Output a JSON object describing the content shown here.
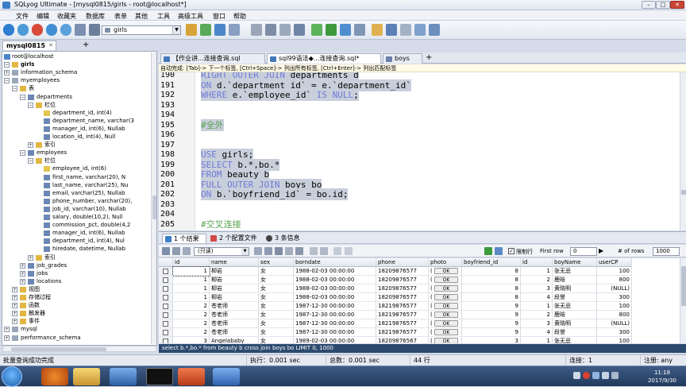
{
  "window": {
    "title": "SQLyog Ultimate - [mysql0815/girls - root@localhost*]"
  },
  "menu": [
    "文件",
    "编辑",
    "收藏夹",
    "数据库",
    "表单",
    "其他",
    "工具",
    "高级工具",
    "窗口",
    "帮助"
  ],
  "toolbar": {
    "db_selector": "girls"
  },
  "connection_tab": {
    "label": "mysql0815",
    "add": "+"
  },
  "tree": {
    "root": "root@localhost",
    "nodes": [
      {
        "label": "girls",
        "bold": true
      },
      {
        "label": "information_schema"
      },
      {
        "label": "myemployees"
      },
      {
        "label": "表"
      },
      {
        "label": "departments"
      },
      {
        "label": "栏位"
      },
      {
        "label": "department_id, int(4)"
      },
      {
        "label": "department_name, varchar(3"
      },
      {
        "label": "manager_id, int(6), Nullab"
      },
      {
        "label": "location_id, int(4), Null"
      },
      {
        "label": "索引"
      },
      {
        "label": "employees"
      },
      {
        "label": "栏位"
      },
      {
        "label": "employee_id, int(6)"
      },
      {
        "label": "first_name, varchar(20), N"
      },
      {
        "label": "last_name, varchar(25), Nu"
      },
      {
        "label": "email, varchar(25), Nullab"
      },
      {
        "label": "phone_number, varchar(20),"
      },
      {
        "label": "job_id, varchar(10), Nullab"
      },
      {
        "label": "salary, double(10,2), Null"
      },
      {
        "label": "commission_pct, double(4,2"
      },
      {
        "label": "manager_id, int(6), Nullab"
      },
      {
        "label": "department_id, int(4), Nul"
      },
      {
        "label": "hiredate, datetime, Nullab"
      },
      {
        "label": "索引"
      },
      {
        "label": "job_grades"
      },
      {
        "label": "jobs"
      },
      {
        "label": "locations"
      },
      {
        "label": "视图"
      },
      {
        "label": "存储过程"
      },
      {
        "label": "函数"
      },
      {
        "label": "触发器"
      },
      {
        "label": "事件"
      },
      {
        "label": "mysql"
      },
      {
        "label": "performance_schema"
      }
    ]
  },
  "editor_tabs": [
    {
      "label": "【作业讲...连接查询.sql"
    },
    {
      "label": "sql99语法◆...连接查询.sql*"
    },
    {
      "label": "boys"
    }
  ],
  "editor_tab_add": "+",
  "hint": "自动完成: [Tab]-> 下一个标签, [Ctrl+Space]-> 列出所有标签, [Ctrl+Enter]-> 列出匹配标签",
  "code_lines": [
    {
      "n": "190",
      "text": "RIGHT OUTER JOIN departments d"
    },
    {
      "n": "191",
      "text": "ON d.`department_id` = e.`department_id`"
    },
    {
      "n": "192",
      "text": "WHERE e.`employee_id` IS NULL;"
    },
    {
      "n": "193",
      "text": ""
    },
    {
      "n": "194",
      "text": ""
    },
    {
      "n": "195",
      "text": "#全外"
    },
    {
      "n": "196",
      "text": ""
    },
    {
      "n": "197",
      "text": ""
    },
    {
      "n": "198",
      "text": "USE girls;"
    },
    {
      "n": "199",
      "text": "SELECT b.*,bo.*"
    },
    {
      "n": "200",
      "text": "FROM beauty b"
    },
    {
      "n": "201",
      "text": "FULL OUTER JOIN boys bo"
    },
    {
      "n": "202",
      "text": "ON b.`boyfriend_id` = bo.id;"
    },
    {
      "n": "203",
      "text": ""
    },
    {
      "n": "204",
      "text": ""
    },
    {
      "n": "205",
      "text": "#交叉连接"
    }
  ],
  "result_tabs": [
    {
      "label": "1 个结果"
    },
    {
      "label": "2 个配置文件"
    },
    {
      "label": "3 条信息"
    }
  ],
  "result_toolbar": {
    "mode": "(只读)",
    "limit_label": "限制行",
    "first_row_label": "First row",
    "first_row_value": "0",
    "rows_label": "# of rows",
    "rows_value": "1000"
  },
  "grid": {
    "columns": [
      "id",
      "name",
      "sex",
      "borndate",
      "phone",
      "photo",
      "boyfriend_id",
      "id",
      "boyName",
      "userCP"
    ],
    "rows": [
      [
        "1",
        "柳岩",
        "女",
        "1988-02-03 00:00:00",
        "18209876577",
        "OK",
        "8",
        "1",
        "张无忌",
        "100"
      ],
      [
        "1",
        "柳岩",
        "女",
        "1988-02-03 00:00:00",
        "18209876577",
        "OK",
        "8",
        "2",
        "鹿晗",
        "800"
      ],
      [
        "1",
        "柳岩",
        "女",
        "1988-02-03 00:00:00",
        "18209876577",
        "OK",
        "8",
        "3",
        "黄晓明",
        "(NULL)"
      ],
      [
        "1",
        "柳岩",
        "女",
        "1988-02-03 00:00:00",
        "18209876577",
        "OK",
        "8",
        "4",
        "段誉",
        "300"
      ],
      [
        "2",
        "苍老师",
        "女",
        "1987-12-30 00:00:00",
        "18219876577",
        "OK",
        "9",
        "1",
        "张无忌",
        "100"
      ],
      [
        "2",
        "苍老师",
        "女",
        "1987-12-30 00:00:00",
        "18219876577",
        "OK",
        "9",
        "2",
        "鹿晗",
        "800"
      ],
      [
        "2",
        "苍老师",
        "女",
        "1987-12-30 00:00:00",
        "18219876577",
        "OK",
        "9",
        "3",
        "黄晓明",
        "(NULL)"
      ],
      [
        "2",
        "苍老师",
        "女",
        "1987-12-30 00:00:00",
        "18219876577",
        "OK",
        "9",
        "4",
        "段誉",
        "300"
      ],
      [
        "3",
        "Angelababy",
        "女",
        "1989-02-03 00:00:00",
        "18209876567",
        "OK",
        "3",
        "1",
        "张无忌",
        "100"
      ]
    ]
  },
  "sql_status": "select b.*,bo.* from beauty b cross join boys bo LIMIT 0, 1000",
  "statusbar": {
    "message": "批量查询成功完成",
    "exec": "执行：0.001 sec",
    "total": "总数：0.001 sec",
    "rows": "44 行",
    "conn": "连接：1",
    "user": "注册: any"
  },
  "clock": {
    "time": "11:18",
    "date": "2017/9/30"
  },
  "colors": {
    "keyword": "#6f79d8",
    "comment": "#56a24e",
    "selection": "#c8cfdb",
    "sqlbar": "#2c4a6e"
  }
}
